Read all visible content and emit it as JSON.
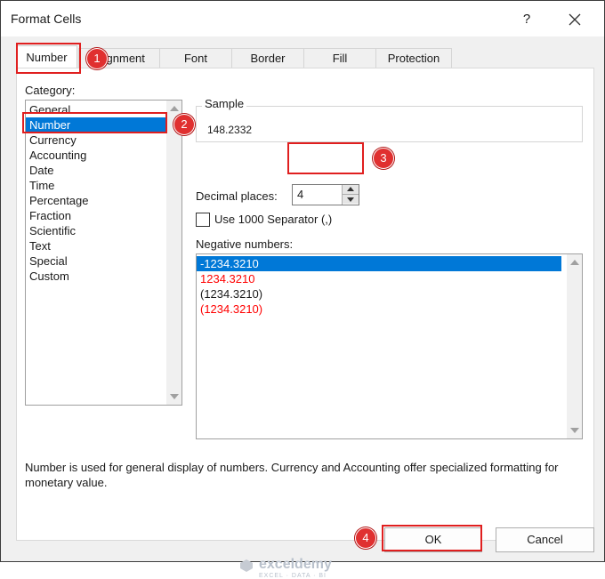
{
  "window": {
    "title": "Format Cells",
    "help_label": "?"
  },
  "tabs": [
    {
      "label": "Number"
    },
    {
      "label": "Alignment"
    },
    {
      "label": "Font"
    },
    {
      "label": "Border"
    },
    {
      "label": "Fill"
    },
    {
      "label": "Protection"
    }
  ],
  "category": {
    "label": "Category:",
    "items": [
      "General",
      "Number",
      "Currency",
      "Accounting",
      "Date",
      "Time",
      "Percentage",
      "Fraction",
      "Scientific",
      "Text",
      "Special",
      "Custom"
    ],
    "selected": "Number"
  },
  "sample": {
    "label": "Sample",
    "value": "148.2332"
  },
  "decimal": {
    "label": "Decimal places:",
    "value": "4"
  },
  "separator": {
    "label": "Use 1000 Separator (,)",
    "checked": false
  },
  "negative": {
    "label": "Negative numbers:",
    "items": [
      {
        "text": "-1234.3210",
        "color": "#000000"
      },
      {
        "text": "1234.3210",
        "color": "#ff0000"
      },
      {
        "text": "(1234.3210)",
        "color": "#000000"
      },
      {
        "text": "(1234.3210)",
        "color": "#ff0000"
      }
    ]
  },
  "description": "Number is used for general display of numbers.  Currency and Accounting offer specialized formatting for monetary value.",
  "buttons": {
    "ok": "OK",
    "cancel": "Cancel"
  },
  "annotations": [
    "1",
    "2",
    "3",
    "4"
  ],
  "watermark": {
    "name": "exceldemy",
    "tagline": "EXCEL · DATA · BI"
  },
  "colors": {
    "selection": "#0078d7",
    "highlight": "#e01f1f",
    "badge": "#e03030"
  }
}
